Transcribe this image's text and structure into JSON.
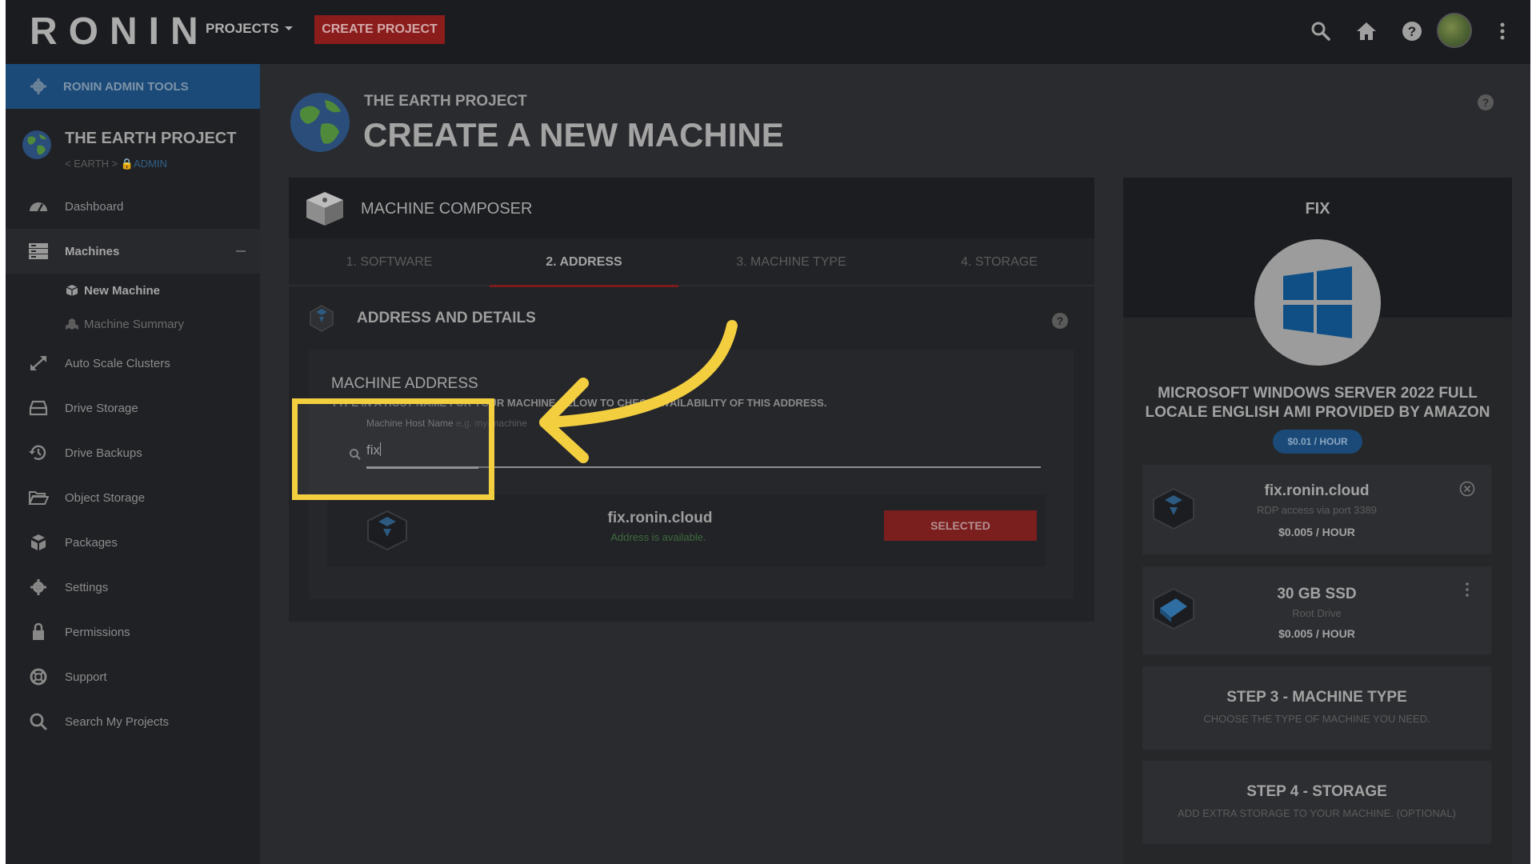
{
  "topbar": {
    "logo": "RONIN",
    "projects_menu": "PROJECTS",
    "create_project": "CREATE PROJECT",
    "icons": [
      "search-icon",
      "home-icon",
      "help-icon",
      "avatar",
      "kebab-menu-icon"
    ]
  },
  "sidebar": {
    "admin_tools": "RONIN ADMIN TOOLS",
    "project_name": "THE EARTH PROJECT",
    "crumb_prefix": "< EARTH >",
    "crumb_role": "ADMIN",
    "items": [
      {
        "label": "Dashboard",
        "icon": "dashboard-icon"
      },
      {
        "label": "Machines",
        "icon": "machines-icon"
      },
      {
        "label": "Auto Scale Clusters",
        "icon": "expand-arrows-icon"
      },
      {
        "label": "Drive Storage",
        "icon": "drive-icon"
      },
      {
        "label": "Drive Backups",
        "icon": "history-icon"
      },
      {
        "label": "Object Storage",
        "icon": "folder-open-icon"
      },
      {
        "label": "Packages",
        "icon": "packages-icon"
      },
      {
        "label": "Settings",
        "icon": "gear-icon"
      },
      {
        "label": "Permissions",
        "icon": "lock-icon"
      },
      {
        "label": "Support",
        "icon": "lifebuoy-icon"
      },
      {
        "label": "Search My Projects",
        "icon": "search-icon"
      }
    ],
    "sub_items": [
      {
        "label": "New Machine",
        "icon": "cube-icon"
      },
      {
        "label": "Machine Summary",
        "icon": "cubes-icon"
      }
    ]
  },
  "header": {
    "project": "THE EARTH PROJECT",
    "title": "CREATE A NEW MACHINE"
  },
  "composer": {
    "title": "MACHINE COMPOSER",
    "tabs": [
      "1. SOFTWARE",
      "2. ADDRESS",
      "3. MACHINE TYPE",
      "4. STORAGE"
    ],
    "active_tab": "2. ADDRESS",
    "section_title": "ADDRESS AND DETAILS",
    "address_title": "MACHINE ADDRESS",
    "address_hint": "TYPE IN A HOST NAME FOR YOUR MACHINE BELOW TO CHECK AVAILABILITY OF THIS ADDRESS.",
    "field_label": "Machine Host Name",
    "field_placeholder": "e.g. my-machine",
    "field_value": "fix",
    "result_name": "fix.ronin.cloud",
    "result_status": "Address is available.",
    "result_button": "SELECTED"
  },
  "summary": {
    "label": "FIX",
    "os_name": "MICROSOFT WINDOWS SERVER 2022 FULL LOCALE ENGLISH AMI PROVIDED BY AMAZON",
    "os_price": "$0.01 / HOUR",
    "address_card": {
      "name": "fix.ronin.cloud",
      "detail": "RDP access via port 3389",
      "price": "$0.005 / HOUR"
    },
    "storage_card": {
      "name": "30 GB SSD",
      "detail": "Root Drive",
      "price": "$0.005 / HOUR"
    },
    "step3": {
      "title": "STEP 3 - MACHINE TYPE",
      "desc": "CHOOSE THE TYPE OF MACHINE YOU NEED."
    },
    "step4": {
      "title": "STEP 4 - STORAGE",
      "desc": "ADD EXTRA STORAGE TO YOUR MACHINE. (OPTIONAL)"
    }
  },
  "colors": {
    "accent_red": "#7b1e1e",
    "accent_blue": "#1b4a78",
    "annotation_yellow": "#f3cf40",
    "available_green": "#3d6b3e"
  }
}
